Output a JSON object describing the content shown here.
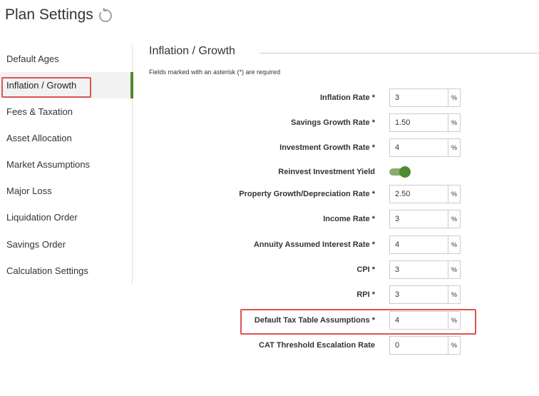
{
  "page": {
    "title": "Plan Settings"
  },
  "sidebar": {
    "items": [
      {
        "label": "Default Ages",
        "active": false
      },
      {
        "label": "Inflation / Growth",
        "active": true
      },
      {
        "label": "Fees & Taxation",
        "active": false
      },
      {
        "label": "Asset Allocation",
        "active": false
      },
      {
        "label": "Market Assumptions",
        "active": false
      },
      {
        "label": "Major Loss",
        "active": false
      },
      {
        "label": "Liquidation Order",
        "active": false
      },
      {
        "label": "Savings Order",
        "active": false
      },
      {
        "label": "Calculation Settings",
        "active": false
      }
    ]
  },
  "section": {
    "title": "Inflation / Growth",
    "required_note": "Fields marked with an asterisk (*) are required"
  },
  "fields": {
    "inflation_rate": {
      "label": "Inflation Rate *",
      "value": "3",
      "unit": "%"
    },
    "savings_growth_rate": {
      "label": "Savings Growth Rate *",
      "value": "1.50",
      "unit": "%"
    },
    "investment_growth_rate": {
      "label": "Investment Growth Rate *",
      "value": "4",
      "unit": "%"
    },
    "reinvest_investment_yield": {
      "label": "Reinvest Investment Yield",
      "on": true
    },
    "property_growth_rate": {
      "label": "Property Growth/Depreciation Rate *",
      "value": "2.50",
      "unit": "%"
    },
    "income_rate": {
      "label": "Income Rate *",
      "value": "3",
      "unit": "%"
    },
    "annuity_interest_rate": {
      "label": "Annuity Assumed Interest Rate *",
      "value": "4",
      "unit": "%"
    },
    "cpi": {
      "label": "CPI *",
      "value": "3",
      "unit": "%"
    },
    "rpi": {
      "label": "RPI *",
      "value": "3",
      "unit": "%"
    },
    "default_tax_table": {
      "label": "Default Tax Table Assumptions *",
      "value": "4",
      "unit": "%"
    },
    "cat_threshold": {
      "label": "CAT Threshold Escalation Rate",
      "value": "0",
      "unit": "%"
    }
  },
  "colors": {
    "accent": "#4e8a2e",
    "highlight": "#e05252"
  }
}
